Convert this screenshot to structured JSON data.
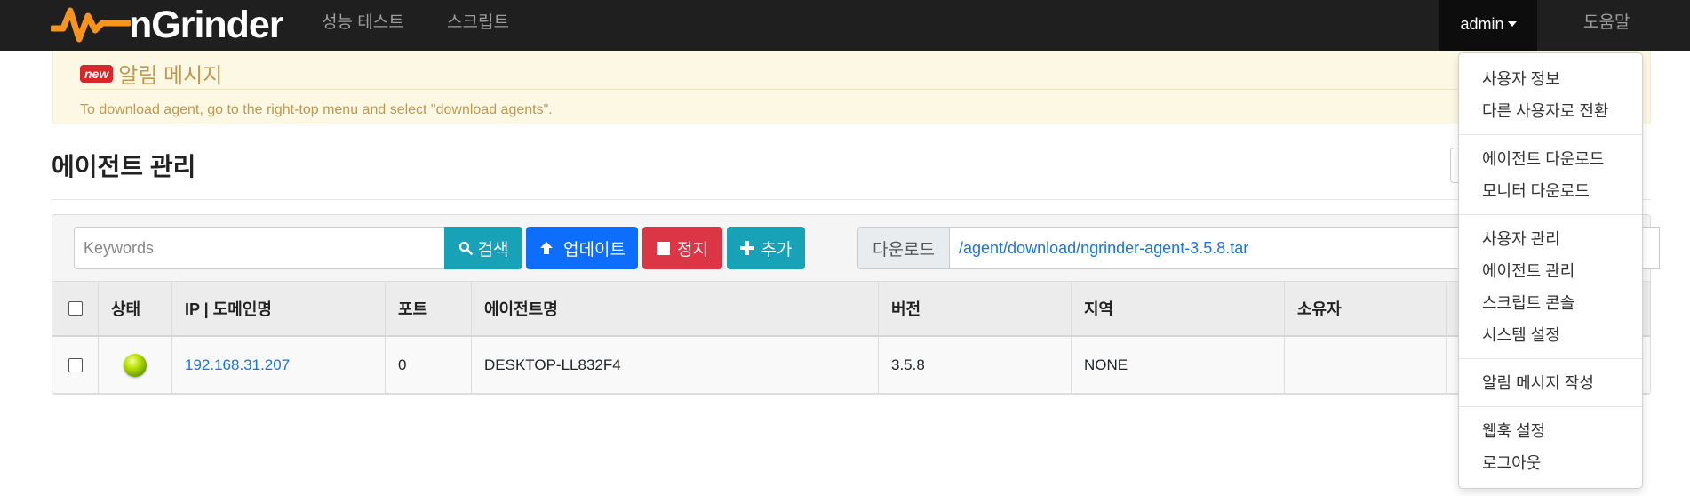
{
  "navbar": {
    "brand": "nGrinder",
    "perf_test": "성능 테스트",
    "script": "스크립트",
    "user": "admin",
    "help": "도움말",
    "bg_color": "#1f1f1f"
  },
  "notice": {
    "badge": "new",
    "title": "알림 메시지",
    "body": "To download agent, go to the right-top menu and select \"download agents\"."
  },
  "page": {
    "title": "에이전트 관리"
  },
  "toolbar": {
    "search_placeholder": "Keywords",
    "search_label": "검색",
    "update_label": "업데이트",
    "stop_label": "정지",
    "add_label": "추가",
    "download_label": "다운로드",
    "download_link": "/agent/download/ngrinder-agent-3.5.8.tar"
  },
  "table": {
    "headers": [
      "상태",
      "IP | 도메인명",
      "포트",
      "에이전트명",
      "버전",
      "지역",
      "소유자"
    ],
    "rows": [
      {
        "status": "green",
        "ip": "192.168.31.207",
        "port": "0",
        "name": "DESKTOP-LL832F4",
        "version": "3.5.8",
        "region": "NONE",
        "owner": ""
      }
    ]
  },
  "user_menu": {
    "items": [
      "사용자 정보",
      "다른 사용자로 전환",
      "에이전트 다운로드",
      "모니터 다운로드",
      "사용자 관리",
      "에이전트 관리",
      "스크립트 콘솔",
      "시스템 설정",
      "알림 메시지 작성",
      "웹훅 설정",
      "로그아웃"
    ]
  },
  "colors": {
    "info": "#17a2b8",
    "primary": "#0d6efd",
    "danger": "#dc3545",
    "notice_bg": "#fcf8e3",
    "notice_text": "#c09853"
  }
}
